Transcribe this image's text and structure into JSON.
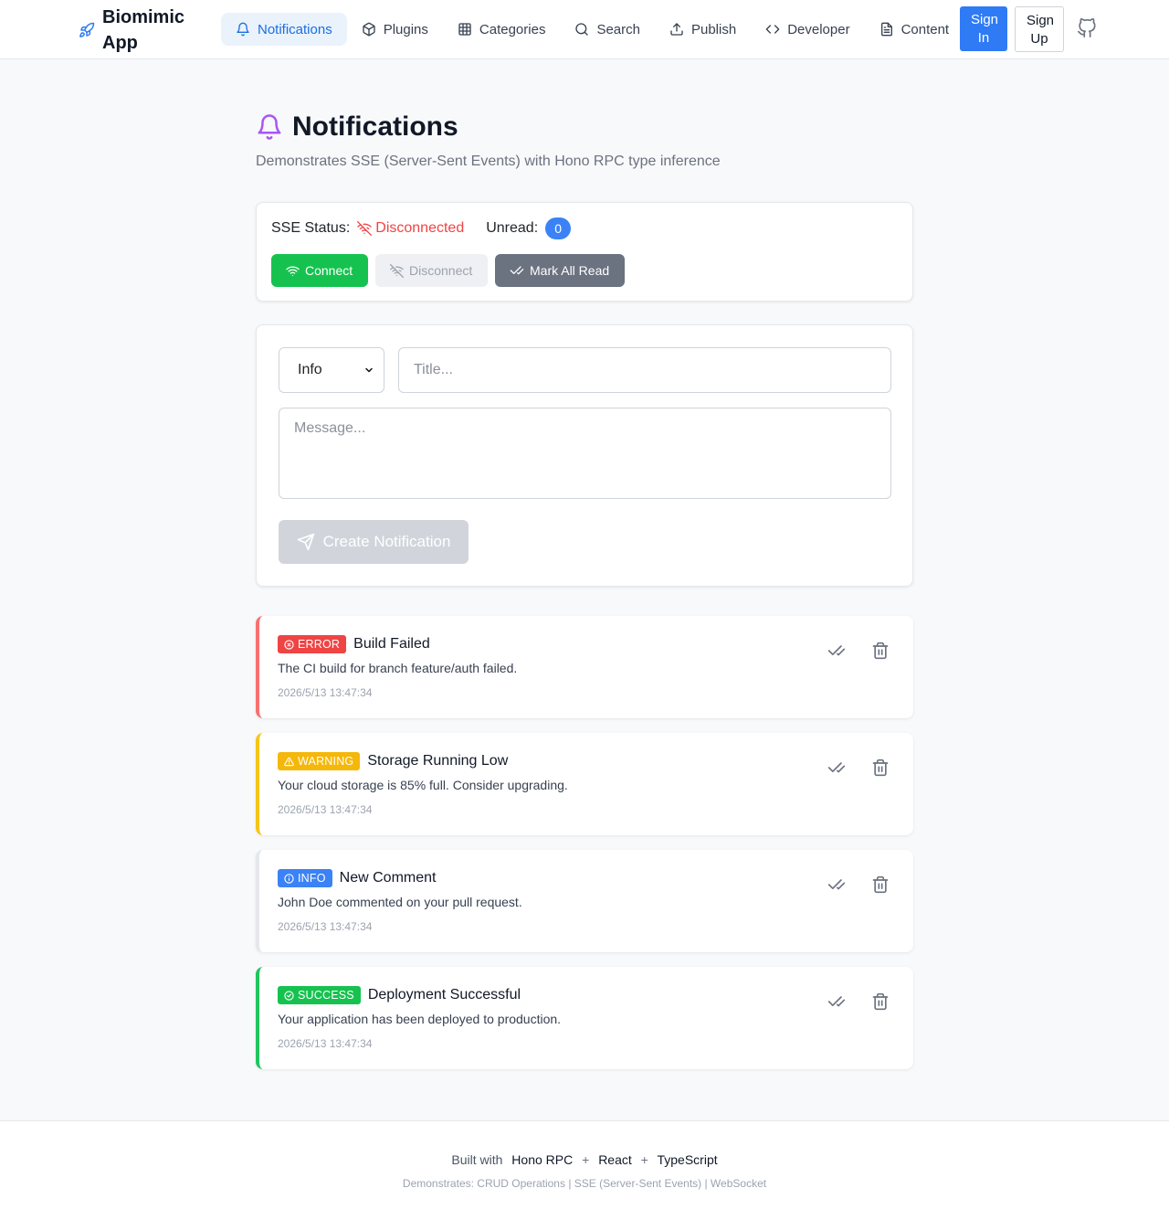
{
  "brand": {
    "name": "Biomimic App",
    "icon": "rocket-icon"
  },
  "nav": {
    "items": [
      {
        "label": "Notifications",
        "icon": "bell-icon",
        "active": true
      },
      {
        "label": "Plugins",
        "icon": "box-icon"
      },
      {
        "label": "Categories",
        "icon": "grid-icon"
      },
      {
        "label": "Search",
        "icon": "search-icon"
      },
      {
        "label": "Publish",
        "icon": "upload-icon"
      },
      {
        "label": "Developer",
        "icon": "code-icon"
      },
      {
        "label": "Content",
        "icon": "file-icon"
      }
    ],
    "sign_in": "Sign In",
    "sign_up": "Sign Up",
    "github_icon": "github-icon"
  },
  "page": {
    "title": "Notifications",
    "subtitle": "Demonstrates SSE (Server-Sent Events) with Hono RPC type inference"
  },
  "status": {
    "label": "SSE Status:",
    "state": "Disconnected",
    "unread_label": "Unread:",
    "unread_count": "0",
    "buttons": {
      "connect": "Connect",
      "disconnect": "Disconnect",
      "mark_all_read": "Mark All Read"
    }
  },
  "form": {
    "type_value": "Info",
    "title_placeholder": "Title...",
    "message_placeholder": "Message...",
    "submit_label": "Create Notification"
  },
  "notifications": [
    {
      "type": "ERROR",
      "title": "Build Failed",
      "message": "The CI build for branch feature/auth failed.",
      "time": "2026/5/13 13:47:34",
      "color": "#ef4444"
    },
    {
      "type": "WARNING",
      "title": "Storage Running Low",
      "message": "Your cloud storage is 85% full. Consider upgrading.",
      "time": "2026/5/13 13:47:34",
      "color": "#f5b70a"
    },
    {
      "type": "INFO",
      "title": "New Comment",
      "message": "John Doe commented on your pull request.",
      "time": "2026/5/13 13:47:34",
      "color": "#3b82f6"
    },
    {
      "type": "SUCCESS",
      "title": "Deployment Successful",
      "message": "Your application has been deployed to production.",
      "time": "2026/5/13 13:47:34",
      "color": "#16c24f"
    }
  ],
  "footer": {
    "built_with": "Built with",
    "tech": [
      "Hono RPC",
      "React",
      "TypeScript"
    ],
    "plus": "+",
    "demonstrates": "Demonstrates: CRUD Operations | SSE (Server-Sent Events) | WebSocket"
  },
  "colors": {
    "accent": "#2f7bf5",
    "connect": "#16c24f",
    "disconnected": "#ef4444",
    "bell": "#a855f7"
  }
}
